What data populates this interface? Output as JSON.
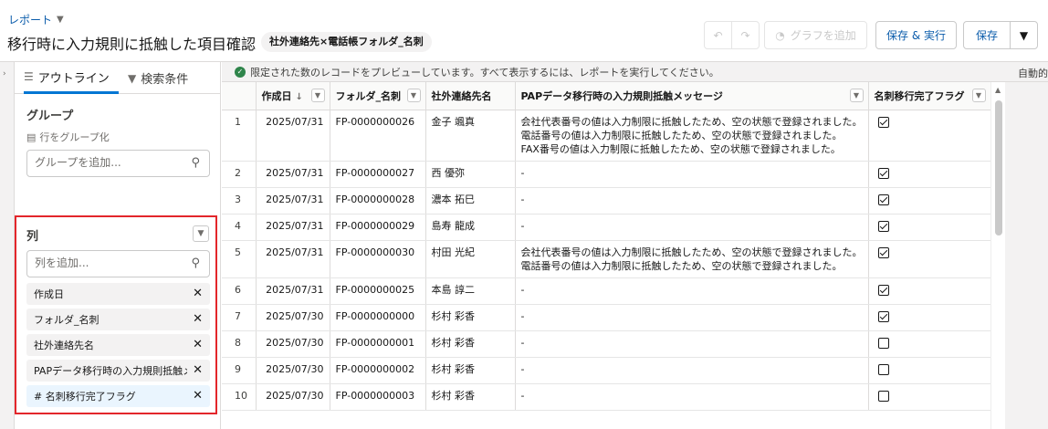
{
  "header": {
    "report_link": "レポート",
    "title": "移行時に入力規則に抵触した項目確認",
    "report_type": "社外連絡先×電話帳フォルダ_名刺",
    "add_chart": "グラフを追加",
    "save_run": "保存 & 実行",
    "save": "保存"
  },
  "left_panel": {
    "tabs": {
      "outline": "アウトライン",
      "filters": "検索条件"
    },
    "groups": {
      "title": "グループ",
      "hint": "行をグループ化",
      "placeholder": "グループを追加..."
    },
    "columns": {
      "title": "列",
      "placeholder": "列を追加...",
      "items": [
        {
          "label": "作成日",
          "prefix": ""
        },
        {
          "label": "フォルダ_名刺",
          "prefix": ""
        },
        {
          "label": "社外連絡先名",
          "prefix": ""
        },
        {
          "label": "PAPデータ移行時の入力規則抵触メッセージ",
          "prefix": ""
        },
        {
          "label": "名刺移行完了フラグ",
          "prefix": "#"
        }
      ]
    }
  },
  "main": {
    "notice": "限定された数のレコードをプレビューしています。すべて表示するには、レポートを実行してください。",
    "auto_label": "自動的",
    "columns": [
      "作成日",
      "フォルダ_名刺",
      "社外連絡先名",
      "PAPデータ移行時の入力規則抵触メッセージ",
      "名刺移行完了フラグ"
    ],
    "sort_indicator": "↓",
    "rows": [
      {
        "n": "1",
        "date": "2025/07/31",
        "folder": "FP-0000000026",
        "name": "金子 颯真",
        "msg": [
          "会社代表番号の値は入力制限に抵触したため、空の状態で登録されました。",
          "電話番号の値は入力制限に抵触したため、空の状態で登録されました。",
          "FAX番号の値は入力制限に抵触したため、空の状態で登録されました。"
        ],
        "flag": true
      },
      {
        "n": "2",
        "date": "2025/07/31",
        "folder": "FP-0000000027",
        "name": "西 優弥",
        "msg": [
          "-"
        ],
        "flag": true
      },
      {
        "n": "3",
        "date": "2025/07/31",
        "folder": "FP-0000000028",
        "name": "濃本 拓巳",
        "msg": [
          "-"
        ],
        "flag": true
      },
      {
        "n": "4",
        "date": "2025/07/31",
        "folder": "FP-0000000029",
        "name": "島寿 龍成",
        "msg": [
          "-"
        ],
        "flag": true
      },
      {
        "n": "5",
        "date": "2025/07/31",
        "folder": "FP-0000000030",
        "name": "村田 光紀",
        "msg": [
          "会社代表番号の値は入力制限に抵触したため、空の状態で登録されました。",
          "電話番号の値は入力制限に抵触したため、空の状態で登録されました。"
        ],
        "flag": true
      },
      {
        "n": "6",
        "date": "2025/07/31",
        "folder": "FP-0000000025",
        "name": "本島 諄二",
        "msg": [
          "-"
        ],
        "flag": true
      },
      {
        "n": "7",
        "date": "2025/07/30",
        "folder": "FP-0000000000",
        "name": "杉村 彩香",
        "msg": [
          "-"
        ],
        "flag": true
      },
      {
        "n": "8",
        "date": "2025/07/30",
        "folder": "FP-0000000001",
        "name": "杉村 彩香",
        "msg": [
          "-"
        ],
        "flag": false
      },
      {
        "n": "9",
        "date": "2025/07/30",
        "folder": "FP-0000000002",
        "name": "杉村 彩香",
        "msg": [
          "-"
        ],
        "flag": false
      },
      {
        "n": "10",
        "date": "2025/07/30",
        "folder": "FP-0000000003",
        "name": "杉村 彩香",
        "msg": [
          "-"
        ],
        "flag": false
      }
    ]
  },
  "colors": {
    "brand_blue": "#0b5cab",
    "highlight_red": "#e3262b",
    "success_green": "#2e844a",
    "chip_bg": "#f3f2f2",
    "chip_highlight": "#eaf5fe"
  },
  "icons": [
    "caret-down-icon",
    "pencil-icon",
    "undo-icon",
    "redo-icon",
    "chart-icon",
    "list-icon",
    "filter-icon",
    "rows-icon",
    "search-icon",
    "close-icon",
    "check-circle-icon",
    "checkbox-icon"
  ]
}
